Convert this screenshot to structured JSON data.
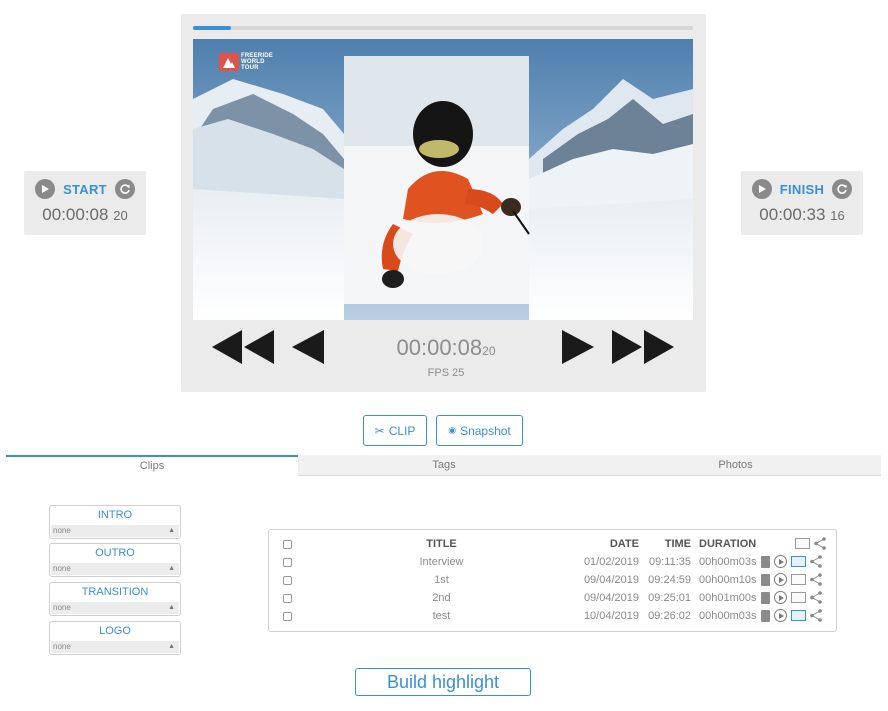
{
  "player": {
    "progress": 0.075,
    "timecode": "00:00:08",
    "timecode_frames": "20",
    "fps": "FPS 25",
    "video_logo": "FREERIDE WORLD TOUR"
  },
  "start": {
    "label": "START",
    "time": "00:00:08",
    "frames": "20"
  },
  "finish": {
    "label": "FINISH",
    "time": "00:00:33",
    "frames": "16"
  },
  "actions": {
    "clip_label": "CLIP",
    "snapshot_label": "Snapshot"
  },
  "tabs": [
    {
      "label": "Clips"
    },
    {
      "label": "Tags"
    },
    {
      "label": "Photos"
    }
  ],
  "selects": [
    {
      "label": "INTRO",
      "value": "none"
    },
    {
      "label": "OUTRO",
      "value": "none"
    },
    {
      "label": "TRANSITION",
      "value": "none"
    },
    {
      "label": "LOGO",
      "value": "none"
    }
  ],
  "table": {
    "headers": {
      "title": "TITLE",
      "date": "DATE",
      "time": "TIME",
      "duration": "DURATION"
    },
    "rows": [
      {
        "title": "Interview",
        "date": "01/02/2019",
        "time": "09:11:35",
        "duration": "00h00m03s"
      },
      {
        "title": "1st",
        "date": "09/04/2019",
        "time": "09:24:59",
        "duration": "00h00m10s"
      },
      {
        "title": "2nd",
        "date": "09/04/2019",
        "time": "09:25:01",
        "duration": "00h01m00s"
      },
      {
        "title": "test",
        "date": "10/04/2019",
        "time": "09:26:02",
        "duration": "00h00m03s"
      }
    ]
  },
  "build_label": "Build highlight",
  "colors": {
    "accent": "#3b8ed8",
    "panel": "#ebebeb",
    "icon_grey": "#8a8a8a"
  }
}
